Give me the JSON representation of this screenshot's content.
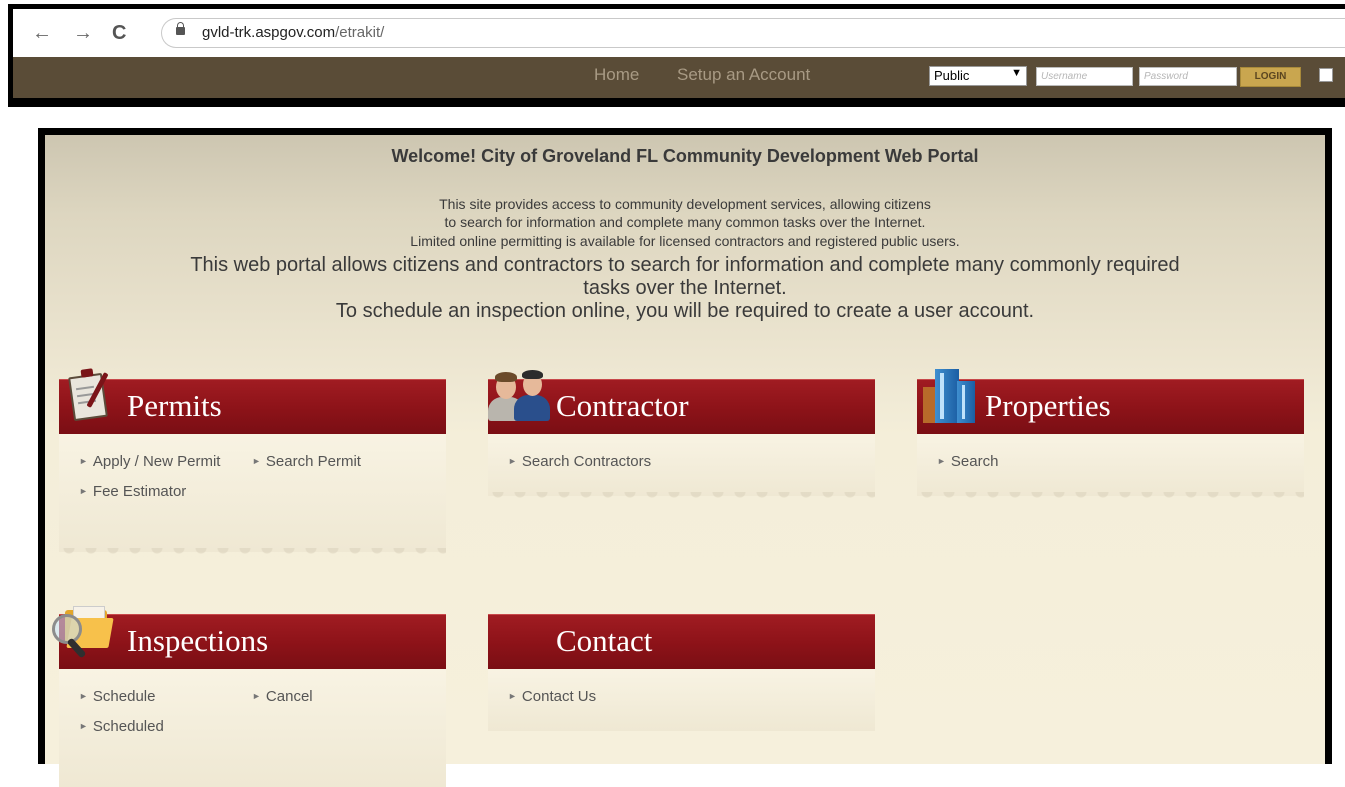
{
  "browser": {
    "back_glyph": "←",
    "forward_glyph": "→",
    "reload_glyph": "C",
    "url_host": "gvld-trk.aspgov.com",
    "url_path": "/etrakit/"
  },
  "app_nav": {
    "links": [
      "Home",
      "Setup an Account"
    ],
    "role_select_value": "Public",
    "username_placeholder": "Username",
    "password_placeholder": "Password",
    "login_label": "LOGIN"
  },
  "portal": {
    "title": "Welcome! City of Groveland FL Community Development Web Portal",
    "intro_small": [
      "This site provides access to community development services, allowing citizens",
      "to search for information and complete many common tasks over the Internet.",
      "Limited online permitting is available for licensed contractors and registered public users."
    ],
    "intro_large": [
      "This web portal allows citizens and contractors to search for information and complete many commonly required",
      "tasks over the Internet.",
      "To schedule an inspection online, you will be required to create a user account."
    ],
    "bullet_glyph": "►",
    "cards": {
      "permits": {
        "title": "Permits",
        "links": [
          "Apply / New Permit",
          "Search Permit",
          "Fee Estimator"
        ],
        "icon": "clipboard-icon"
      },
      "contractor": {
        "title": "Contractor",
        "links": [
          "Search Contractors"
        ],
        "icon": "people-icon"
      },
      "properties": {
        "title": "Properties",
        "links": [
          "Search"
        ],
        "icon": "building-icon"
      },
      "inspections": {
        "title": "Inspections",
        "links": [
          "Schedule",
          "Cancel",
          "Scheduled"
        ],
        "icon": "folder-magnifier-icon"
      },
      "contact": {
        "title": "Contact",
        "links": [
          "Contact Us"
        ]
      }
    }
  },
  "colors": {
    "nav_bar": "#5a4c37",
    "card_band": "#8e1319",
    "login_button": "#c9a64f",
    "portal_background": "#f4eed9"
  }
}
